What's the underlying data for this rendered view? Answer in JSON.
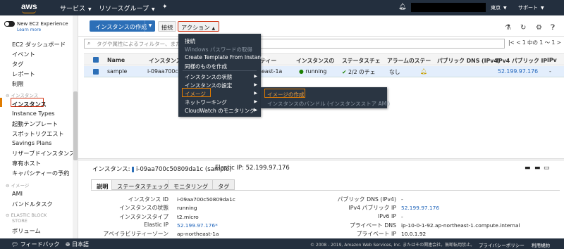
{
  "topbar": {
    "logo": "aws",
    "services": "サービス",
    "resource_groups": "リソースグループ",
    "region": "東京",
    "support": "サポート"
  },
  "sidebar": {
    "new_experience": "New EC2 Experience",
    "learn_more": "Learn more",
    "items_top": [
      "EC2 ダッシュボード",
      "イベント",
      "タグ",
      "レポート",
      "制限"
    ],
    "section_instances": "インスタンス",
    "instance_items": [
      "インスタンス",
      "Instance Types",
      "起動テンプレート",
      "スポットリクエスト",
      "Savings Plans",
      "リザーブドインスタンス",
      "専有ホスト",
      "キャパシティーの予約"
    ],
    "section_images": "イメージ",
    "image_items": [
      "AMI",
      "バンドルタスク"
    ],
    "section_ebs_1": "ELASTIC BLOCK",
    "section_ebs_2": "STORE",
    "ebs_items": [
      "ボリューム"
    ]
  },
  "toolbar": {
    "launch": "インスタンスの作成",
    "connect": "接続",
    "actions": "アクション"
  },
  "search": {
    "placeholder": "タグや属性によるフィルター、または"
  },
  "pager": "1 中の 1 〜 1",
  "table": {
    "headers": [
      "Name",
      "インスタンス",
      "イラビリティー",
      "インスタンスの",
      "ステータスチェ",
      "アラームのステー",
      "パブリック DNS (IPv4)",
      "IPv4 パブリック IP",
      "IPv"
    ],
    "row": {
      "name": "sample",
      "instance_id": "i-09aa700c",
      "az": "ortheast-1a",
      "state": "running",
      "status": "2/2 のチェ",
      "alarm": "なし",
      "ipv4": "52.199.97.176",
      "ipv6": "-"
    }
  },
  "action_menu": {
    "items": [
      "接続",
      "Windows パスワードの取得",
      "Create Template From Instance",
      "同様のものを作成",
      "インスタンスの状態",
      "インスタンスの設定",
      "イメージ",
      "ネットワーキング",
      "CloudWatch のモニタリング"
    ]
  },
  "image_submenu": {
    "create_image": "イメージの作成",
    "bundle": "インスタンスのバンドル (インスタンスストア AMI)"
  },
  "details": {
    "header_label": "インスタンス:",
    "header_value": "i-09aa700c50809da1c (sample)",
    "elastic_header": "Elastic IP: 52.199.97.176",
    "tabs": [
      "説明",
      "ステータスチェック",
      "モニタリング",
      "タグ"
    ],
    "left_labels": [
      "インスタンス ID",
      "インスタンスの状態",
      "インスタンスタイプ",
      "Elastic IP",
      "アベイラビリティーゾーン"
    ],
    "left_values": [
      "i-09aa700c50809da1c",
      "running",
      "t2.micro",
      "52.199.97.176*",
      "ap-northeast-1a"
    ],
    "right_labels": [
      "パブリック DNS (IPv4)",
      "IPv4 パブリック IP",
      "IPv6 IP",
      "プライベート DNS",
      "プライベート IP"
    ],
    "right_values": [
      "-",
      "52.199.97.176",
      "-",
      "ip-10-0-1-92.ap-northeast-1.compute.internal",
      "10.0.1.92"
    ]
  },
  "footer": {
    "feedback": "フィードバック",
    "language": "日本語",
    "copyright": "© 2008 - 2019, Amazon Web Services, Inc. またはその関連会社。無断転用禁止。",
    "privacy": "プライバシーポリシー",
    "terms": "利用規約"
  },
  "colors": {
    "accent": "#e07b00",
    "highlight_red": "#d13212",
    "primary": "#2c6fb7",
    "nav_bg": "#232f3e"
  }
}
